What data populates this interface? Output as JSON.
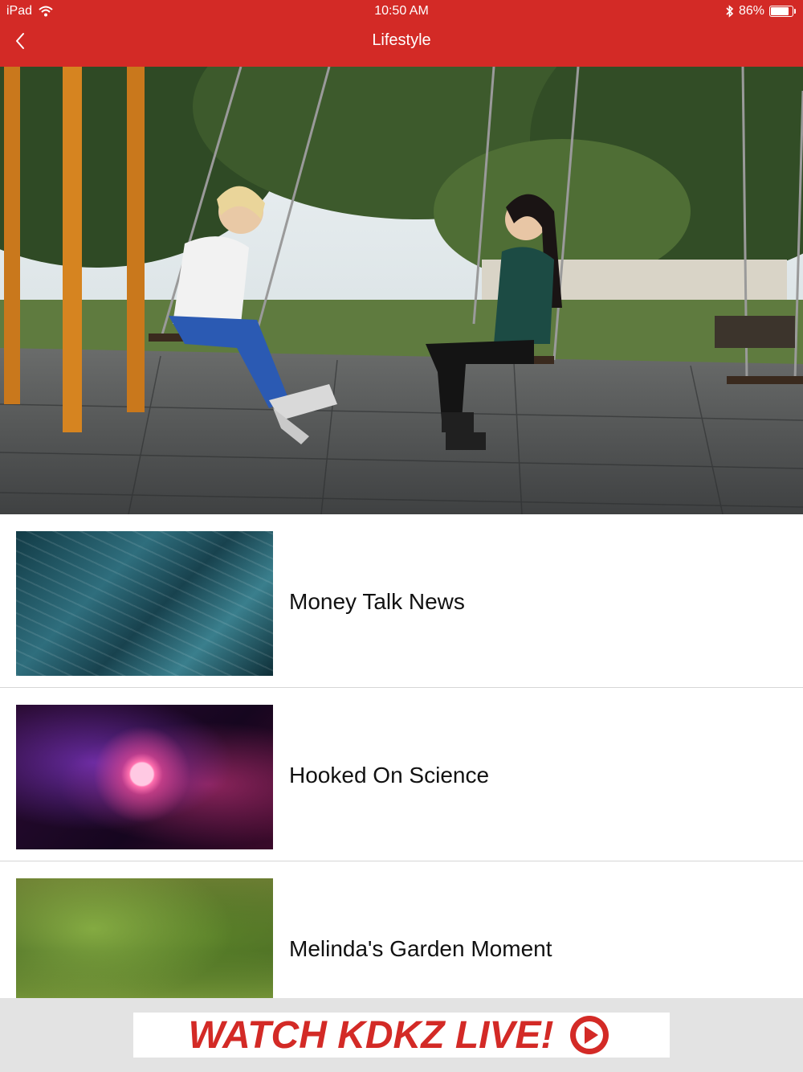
{
  "status_bar": {
    "device": "iPad",
    "time": "10:50 AM",
    "battery": "86%",
    "battery_level": 0.86
  },
  "nav": {
    "title": "Lifestyle",
    "back_icon": "chevron-left-icon"
  },
  "hero": {
    "icon": "hero-photo"
  },
  "list": {
    "items": [
      {
        "title": "Money Talk News"
      },
      {
        "title": "Hooked On Science"
      },
      {
        "title": "Melinda's Garden Moment"
      }
    ]
  },
  "footer": {
    "banner_text": "WATCH KDKZ LIVE!",
    "play_icon": "play-circle-icon"
  },
  "colors": {
    "brand": "#d32a26",
    "footer_bg": "#e3e3e3",
    "divider": "#d6d6d6"
  }
}
